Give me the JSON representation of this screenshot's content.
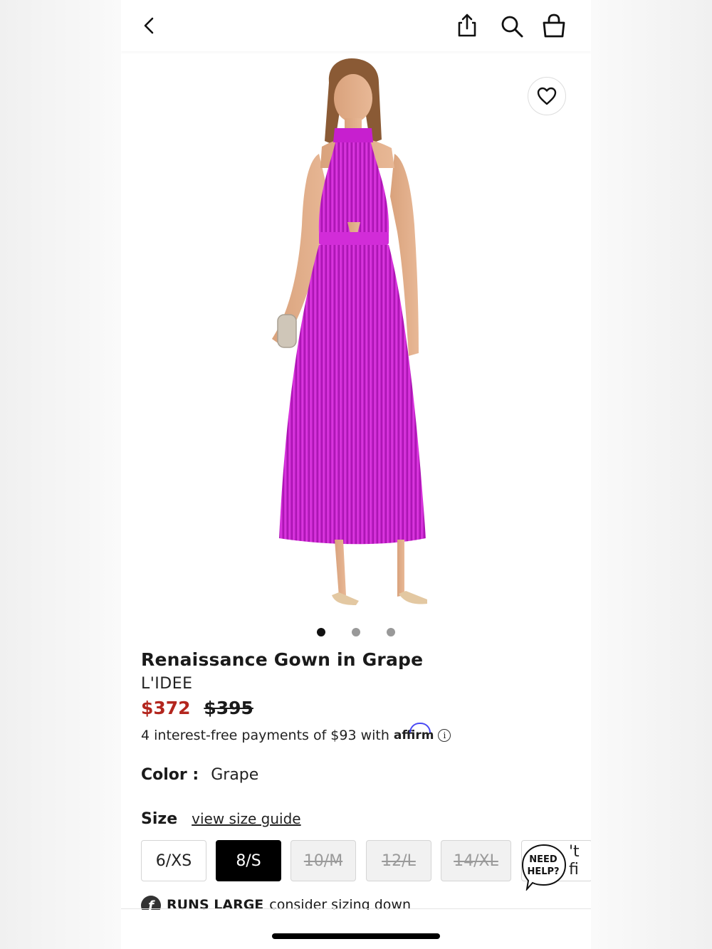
{
  "header": {
    "icons": [
      "back-icon",
      "share-icon",
      "search-icon",
      "bag-icon"
    ]
  },
  "gallery": {
    "dot_count": 3,
    "active_dot": 0,
    "image_subject": "magenta pleated halter gown",
    "dress_color": "#c81fcf"
  },
  "product": {
    "title": "Renaissance Gown in Grape",
    "brand": "L'IDEE",
    "price_sale": "$372",
    "price_original": "$395",
    "sale_color": "#b3261e",
    "installments_text": "4 interest-free payments of $93 with",
    "affirm_label": "affirm",
    "info_glyph": "i"
  },
  "color": {
    "label": "Color :",
    "value": "Grape"
  },
  "size": {
    "label": "Size",
    "guide_link": "view size guide",
    "options": [
      {
        "label": "6/XS",
        "state": "available"
      },
      {
        "label": "8/S",
        "state": "selected"
      },
      {
        "label": "10/M",
        "state": "sold-out"
      },
      {
        "label": "12/L",
        "state": "sold-out"
      },
      {
        "label": "14/XL",
        "state": "sold-out"
      },
      {
        "label": "'t fi",
        "state": "available"
      }
    ]
  },
  "help": {
    "label_line1": "NEED",
    "label_line2": "HELP?"
  },
  "fit": {
    "icon_glyph": "f",
    "bold": "RUNS LARGE",
    "text": "consider sizing down"
  }
}
